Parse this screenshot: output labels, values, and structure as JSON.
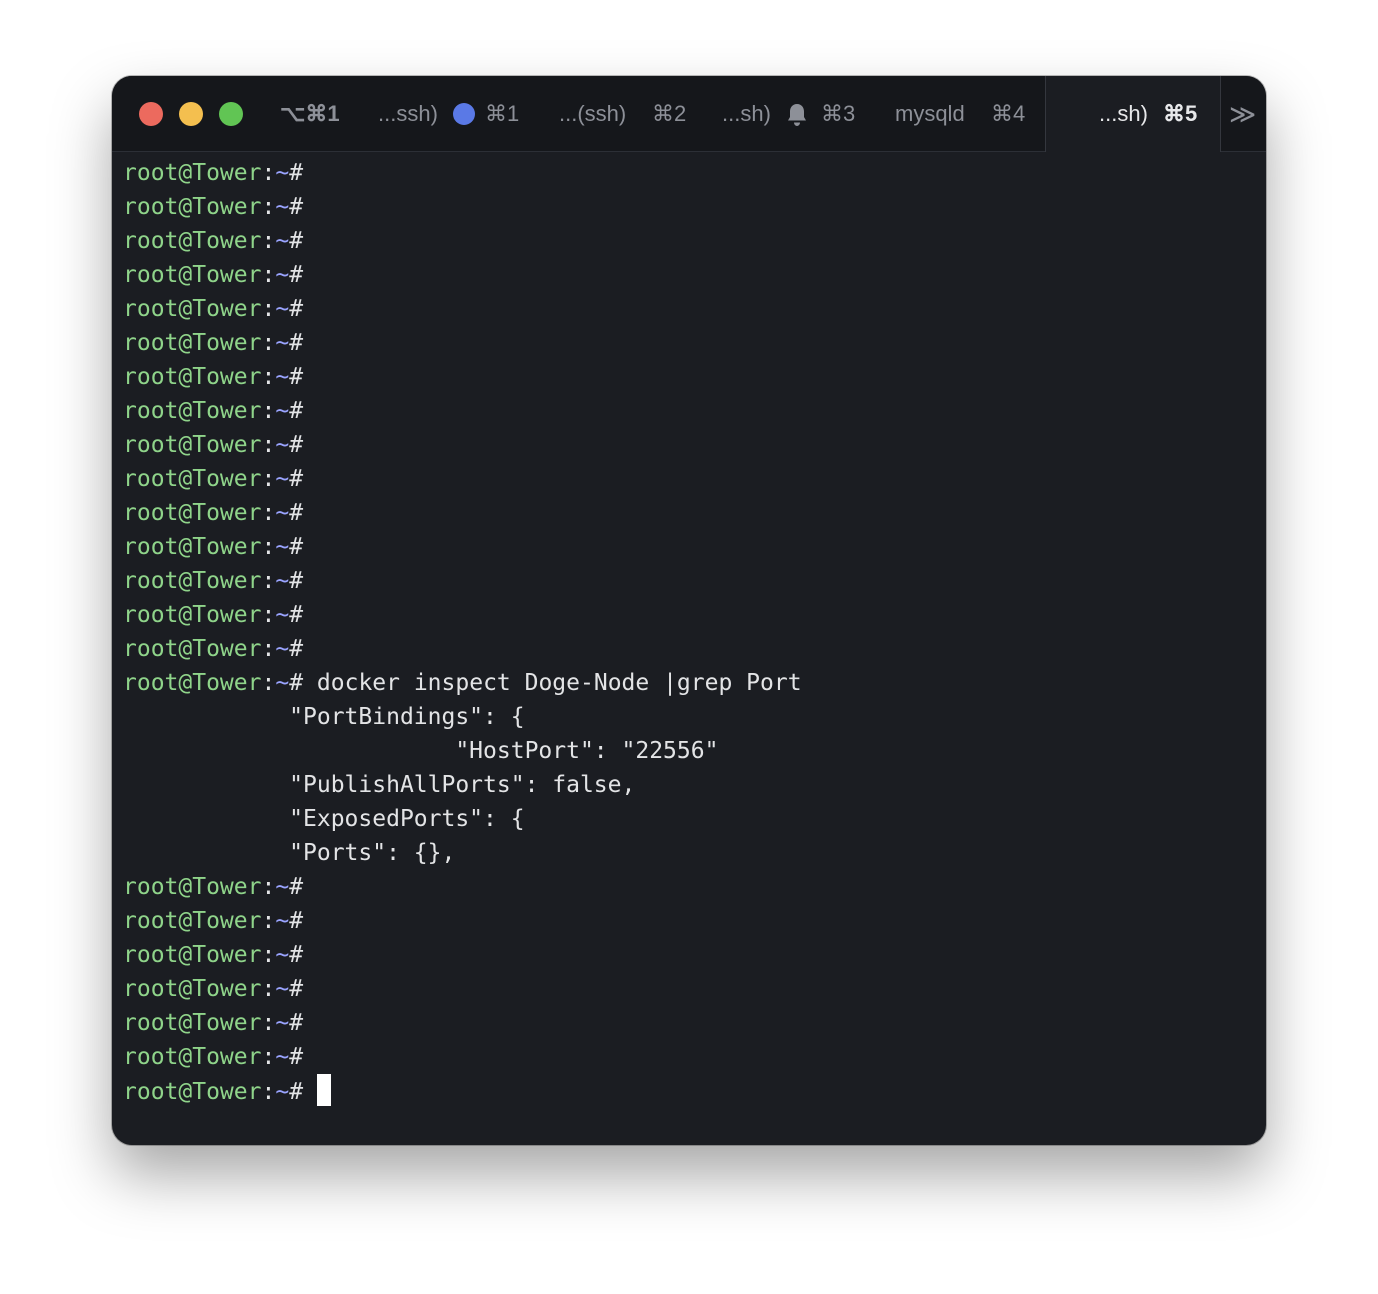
{
  "window": {
    "tabs": [
      {
        "label": "⌥⌘1",
        "shortcut": ""
      },
      {
        "label": "...ssh)",
        "shortcut": "⌘1",
        "indicator": "activity-dot"
      },
      {
        "label": "...(ssh)",
        "shortcut": "⌘2"
      },
      {
        "label": "...sh)",
        "shortcut": "⌘3",
        "indicator": "bell-icon"
      },
      {
        "label": "mysqld",
        "shortcut": "⌘4"
      },
      {
        "label": "...sh)",
        "shortcut": "⌘5",
        "active": true
      }
    ],
    "overflow_glyph": "≫"
  },
  "colors": {
    "background": "#1b1d22",
    "prompt_user": "#8fd48a",
    "prompt_path": "#9aa4ff",
    "activity_dot": "#5a79e6"
  },
  "prompt": {
    "user_host": "root@Tower",
    "colon": ":",
    "path": "~",
    "symbol": "#"
  },
  "terminal": {
    "prompt_lines_before": 15,
    "command": " docker inspect Doge-Node |grep Port",
    "output": [
      "            \"PortBindings\": {",
      "                        \"HostPort\": \"22556\"",
      "            \"PublishAllPorts\": false,",
      "            \"ExposedPorts\": {",
      "            \"Ports\": {},"
    ],
    "prompt_lines_after": 7
  }
}
